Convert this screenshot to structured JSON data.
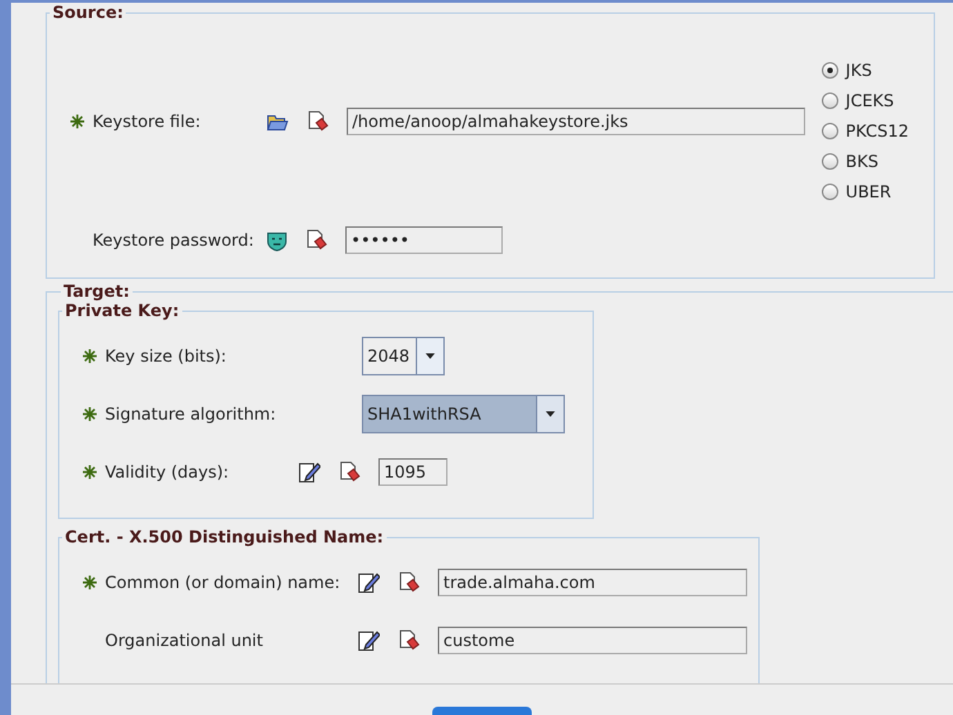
{
  "source": {
    "title": "Source:",
    "fields": [
      {
        "kind": "file",
        "label": "Keystore file:",
        "required": true,
        "value": "/home/anoop/almahakeystore.jks"
      },
      {
        "kind": "password",
        "label": "Keystore password:",
        "required": false,
        "value": "••••••"
      }
    ],
    "types": [
      {
        "label": "JKS",
        "selected": true
      },
      {
        "label": "JCEKS",
        "selected": false
      },
      {
        "label": "PKCS12",
        "selected": false
      },
      {
        "label": "BKS",
        "selected": false
      },
      {
        "label": "UBER",
        "selected": false
      }
    ]
  },
  "target": {
    "title": "Target:",
    "private_key": {
      "title": "Private Key:",
      "fields": [
        {
          "kind": "combo",
          "label": "Key size (bits):",
          "required": true,
          "value": "2048",
          "focused": false
        },
        {
          "kind": "combo",
          "label": "Signature algorithm:",
          "required": true,
          "value": "SHA1withRSA",
          "focused": true
        },
        {
          "kind": "text",
          "label": "Validity (days):",
          "required": true,
          "value": "1095"
        }
      ]
    },
    "dn": {
      "title": "Cert. - X.500 Distinguished Name:",
      "fields": [
        {
          "kind": "text",
          "label": "Common (or domain) name:",
          "required": true,
          "value": "trade.almaha.com"
        },
        {
          "kind": "text",
          "label": "Organizational unit",
          "required": false,
          "value": "custome"
        }
      ]
    }
  }
}
